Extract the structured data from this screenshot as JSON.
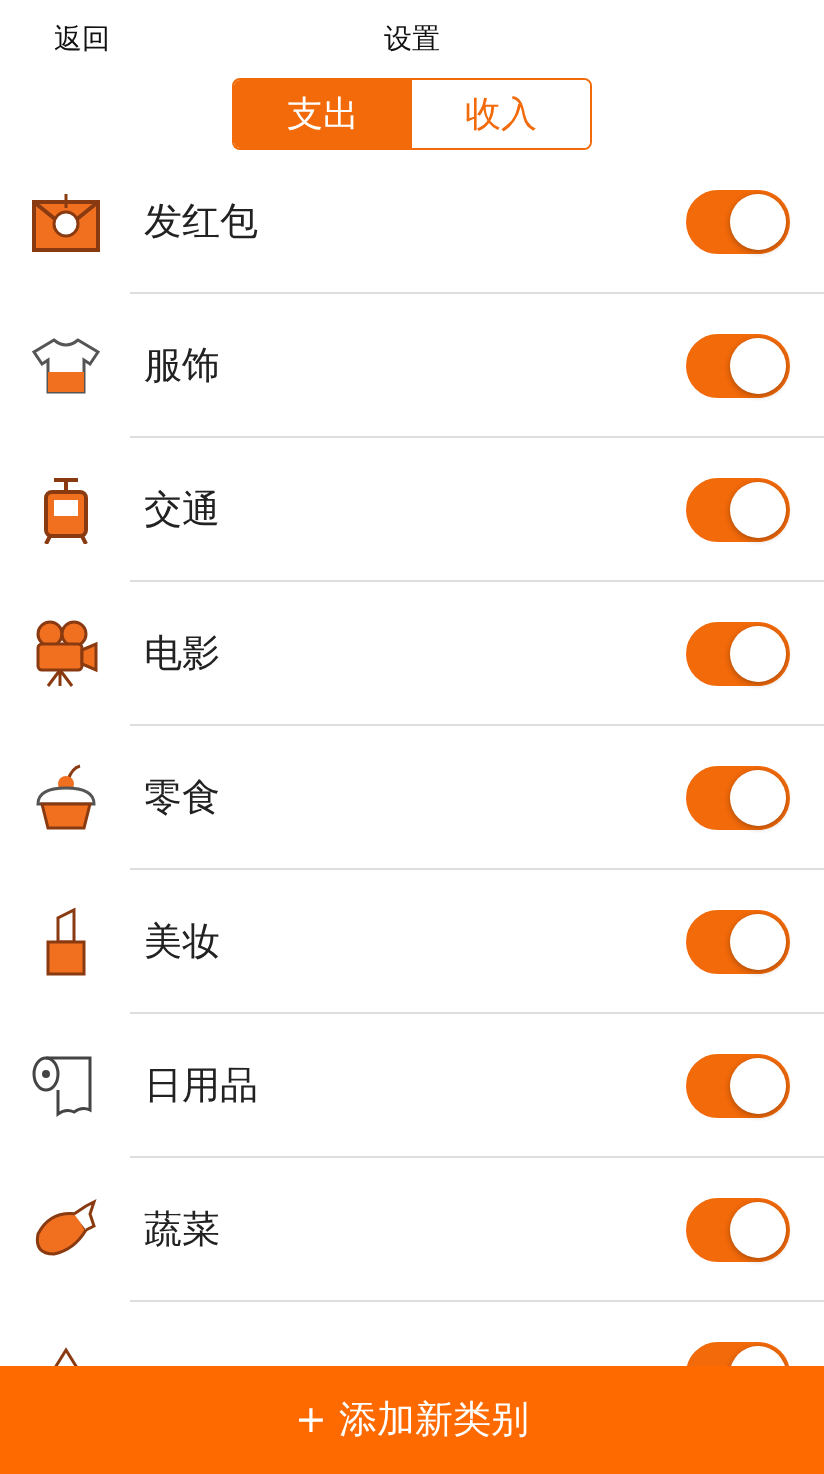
{
  "nav": {
    "back": "返回",
    "title": "设置"
  },
  "tabs": [
    {
      "label": "支出",
      "selected": true
    },
    {
      "label": "收入",
      "selected": false
    }
  ],
  "categories": [
    {
      "name": "发红包",
      "on": true
    },
    {
      "name": "服饰",
      "on": true
    },
    {
      "name": "交通",
      "on": true
    },
    {
      "name": "电影",
      "on": true
    },
    {
      "name": "零食",
      "on": true
    },
    {
      "name": "美妆",
      "on": true
    },
    {
      "name": "日用品",
      "on": true
    },
    {
      "name": "蔬菜",
      "on": true
    },
    {
      "on": true
    }
  ],
  "add_button": "+ 添加新类别"
}
